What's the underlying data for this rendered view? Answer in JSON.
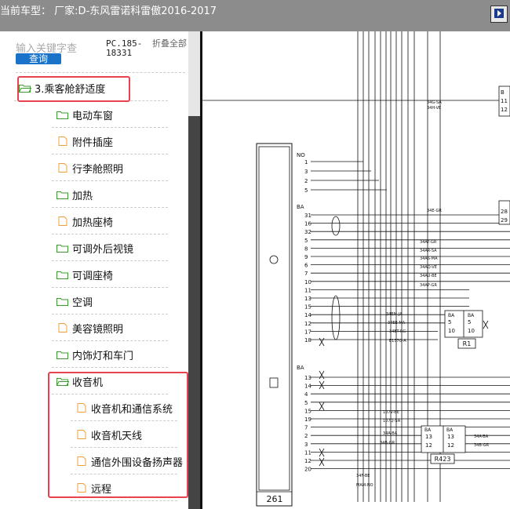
{
  "title": "当前车型：  厂家:D-东风雷诺科雷傲2016-2017",
  "colors": {
    "highlight": "#e8424f",
    "folder_green": "#3a9c2e",
    "file_orange": "#f0a040",
    "search_button": "#1a73c9"
  },
  "search": {
    "placeholder": "输入关键字查",
    "button": "查询"
  },
  "pc_code": "PC.185-18331",
  "collapse_all": "折叠全部",
  "tree": [
    {
      "label": "3.乘客舱舒适度",
      "icon": "folder-open-icon"
    },
    {
      "label": "电动车窗",
      "icon": "folder-icon"
    },
    {
      "label": "附件插座",
      "icon": "file-icon"
    },
    {
      "label": "行李舱照明",
      "icon": "file-icon"
    },
    {
      "label": "加热",
      "icon": "folder-icon"
    },
    {
      "label": "加热座椅",
      "icon": "file-icon"
    },
    {
      "label": "可调外后视镜",
      "icon": "folder-icon"
    },
    {
      "label": "可调座椅",
      "icon": "folder-icon"
    },
    {
      "label": "空调",
      "icon": "folder-icon"
    },
    {
      "label": "美容镜照明",
      "icon": "file-icon"
    },
    {
      "label": "内饰灯和车门",
      "icon": "folder-icon"
    },
    {
      "label": "收音机",
      "icon": "folder-open-icon"
    },
    {
      "label": "收音机和通信系统",
      "icon": "file-icon"
    },
    {
      "label": "收音机天线",
      "icon": "file-icon"
    },
    {
      "label": "通信外围设备扬声器",
      "icon": "file-icon"
    },
    {
      "label": "远程",
      "icon": "file-icon"
    }
  ],
  "diagram": {
    "main_unit": "261",
    "relay_r1": "R1",
    "relay_r423": "R423",
    "connector_no": "NO",
    "connector_ba": "BA",
    "pins_no": [
      "1",
      "3",
      "2",
      "5"
    ],
    "pins_ba1": [
      "31",
      "16",
      "32",
      "5",
      "8",
      "9",
      "6",
      "7",
      "10",
      "11",
      "13",
      "15",
      "14",
      "12",
      "17",
      "18"
    ],
    "pins_ba2": [
      "13",
      "14",
      "4",
      "5",
      "15",
      "19",
      "7",
      "2",
      "3",
      "11",
      "12",
      "20"
    ],
    "wire_labels": [
      "34G-SA",
      "34H-VE",
      "34E-GR",
      "34AT-GR",
      "34AR-SA",
      "34AS-MA",
      "34AQ-VE",
      "34AU-BE",
      "34AP-GR",
      "34EM-JA",
      "34EE-MA",
      "34ET-RG",
      "E137G-A",
      "107V-BE",
      "107Q-SA",
      "34A-BA",
      "34B-GR",
      "34F-BE",
      "MAM-NO"
    ],
    "r1_pins": {
      "conn": "BA",
      "left": [
        "5",
        "10"
      ],
      "right": [
        "5",
        "10"
      ]
    },
    "r423_pins": {
      "conn": "BA",
      "left": [
        "13",
        "12"
      ],
      "right": [
        "13",
        "12"
      ]
    },
    "right_pins_top": [
      "B",
      "11",
      "12"
    ],
    "right_pins_mid": [
      "28",
      "29"
    ],
    "r423_right_labels": [
      "34A-BA",
      "34B-GR"
    ]
  }
}
